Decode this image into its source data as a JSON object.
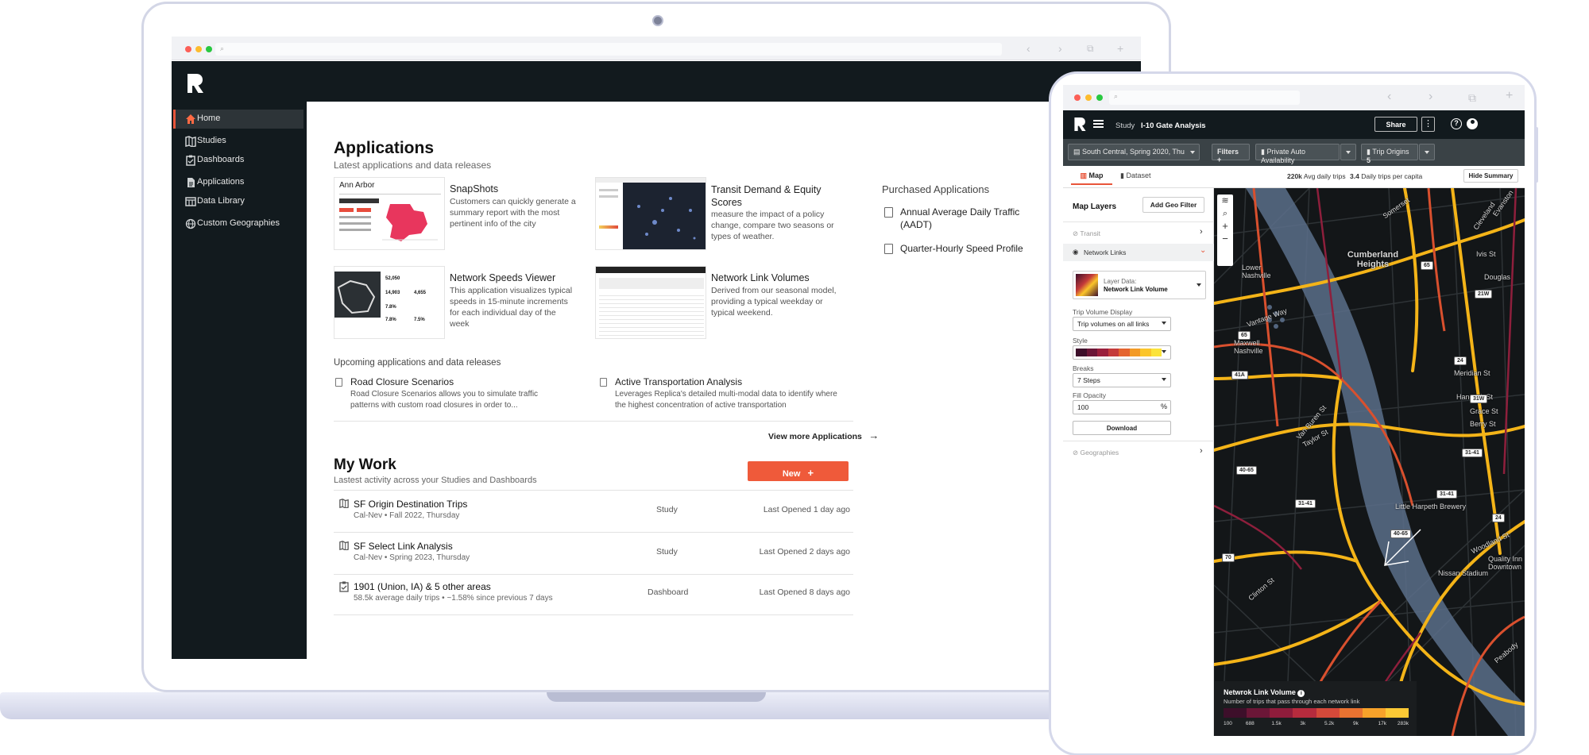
{
  "laptop": {
    "sidebar": {
      "items": [
        {
          "label": "Home",
          "icon": "home-icon"
        },
        {
          "label": "Studies",
          "icon": "map-icon"
        },
        {
          "label": "Dashboards",
          "icon": "clipboard-icon"
        },
        {
          "label": "Applications",
          "icon": "document-icon"
        },
        {
          "label": "Data Library",
          "icon": "table-icon"
        },
        {
          "label": "Custom Geographies",
          "icon": "globe-icon"
        }
      ]
    },
    "applications": {
      "title": "Applications",
      "subtitle": "Latest applications and data releases",
      "apps": [
        {
          "title": "SnapShots",
          "desc": "Customers can quickly generate a summary report with the most pertinent info of the city",
          "thumb_label": "Ann Arbor"
        },
        {
          "title": "Transit Demand & Equity Scores",
          "desc": "measure the impact of a policy change, compare two seasons or types of weather."
        },
        {
          "title": "Network Speeds Viewer",
          "desc": "This application visualizes typical speeds in 15-minute increments for each individual day of the week"
        },
        {
          "title": "Network Link Volumes",
          "desc": "Derived from our seasonal model, providing a typical weekday or typical weekend."
        }
      ],
      "purchased_title": "Purchased Applications",
      "purchased": [
        "Annual Average Daily Traffic (AADT)",
        "Quarter-Hourly Speed Profile"
      ],
      "upcoming_title": "Upcoming applications and data releases",
      "upcoming": [
        {
          "title": "Road Closure Scenarios",
          "desc": "Road Closure Scenarios allows you to simulate traffic patterns with custom road closures in order to..."
        },
        {
          "title": "Active Transportation Analysis",
          "desc": "Leverages Replica's detailed multi-modal data to identify where the highest concentration of active transportation"
        }
      ],
      "view_more": "View more Applications"
    },
    "my_work": {
      "title": "My Work",
      "subtitle": "Lastest activity across your Studies and Dashboards",
      "new_label": "New",
      "rows": [
        {
          "title": "SF Origin Destination Trips",
          "sub": "Cal-Nev • Fall 2022, Thursday",
          "type": "Study",
          "opened": "Last Opened 1 day ago",
          "icon": "map-icon"
        },
        {
          "title": "SF Select Link Analysis",
          "sub": "Cal-Nev • Spring 2023, Thursday",
          "type": "Study",
          "opened": "Last Opened 2 days ago",
          "icon": "map-icon"
        },
        {
          "title": "1901 (Union, IA) & 5 other areas",
          "sub": "58.5k average daily trips • ~1.58% since previous 7 days",
          "type": "Dashboard",
          "opened": "Last Opened 8 days ago",
          "icon": "clipboard-icon"
        }
      ]
    }
  },
  "tablet": {
    "header": {
      "breadcrumb": "Study",
      "title": "I-10 Gate Analysis",
      "share": "Share"
    },
    "filters": {
      "season": "South Central, Spring 2020, Thu",
      "filters_label": "Filters",
      "availability": "Private Auto Availability",
      "origins_label": "Trip Origins",
      "origins_count": "5"
    },
    "tabs": [
      "Map",
      "Dataset"
    ],
    "stats": {
      "daily_trips_value": "220k",
      "daily_trips_label": "Avg daily trips",
      "per_capita_value": "3.4",
      "per_capita_label": "Daily trips per capita",
      "hide_summary": "Hide Summary"
    },
    "panel": {
      "title": "Map Layers",
      "add_geo": "Add Geo Filter",
      "transit": "Transit",
      "network_links": "Network Links",
      "layer_data_label": "Layer Data:",
      "layer_data_value": "Network Link Volume",
      "trip_volume_label": "Trip Volume Display",
      "trip_volume_value": "Trip volumes on all links",
      "style_label": "Style",
      "breaks_label": "Breaks",
      "breaks_value": "7 Steps",
      "opacity_label": "Fill Opacity",
      "opacity_value": "100",
      "download": "Download",
      "geographies": "Geographies"
    },
    "ramp_colors": [
      "#3d0f2a",
      "#6b1637",
      "#9a1f3c",
      "#c43a3a",
      "#e4632e",
      "#f39a25",
      "#fbc52a",
      "#fbe33a"
    ],
    "map_labels": {
      "area1": "Cumberland Heights",
      "area2": "Maxwell Nashville",
      "area3": "Lower Nashville",
      "s1": "Vantage Way",
      "s2": "Hancock St",
      "s3": "Grace St",
      "s4": "Berry St",
      "s5": "Douglas",
      "s6": "Meridian St",
      "s7": "Taylor St",
      "s8": "Van Buren St",
      "s9": "Little Harpeth Brewery",
      "s10": "Quality Inn Downtown",
      "s11": "Nissan Stadium",
      "s12": "Woodland St",
      "s13": "Clinton St",
      "s14": "Peabody",
      "s15": "Somerset",
      "s16": "Cleveland",
      "s17": "Ivis St",
      "s18": "Evanston"
    },
    "shields": [
      "65",
      "21W",
      "65",
      "24",
      "41A",
      "31W",
      "40-65",
      "31-41",
      "40-65",
      "31-41",
      "70",
      "31-41",
      "24"
    ],
    "legend": {
      "title": "Netwrok Link Volume",
      "subtitle": "Number of trips that pass through each network link",
      "ticks": [
        "100",
        "688",
        "1.5k",
        "3k",
        "5.2k",
        "9k",
        "17k",
        "283k"
      ],
      "colors": [
        "#3d0f2a",
        "#6b1637",
        "#8f1c3b",
        "#b62b3d",
        "#d4493a",
        "#e97331",
        "#f7a22a",
        "#fbc935"
      ]
    }
  }
}
